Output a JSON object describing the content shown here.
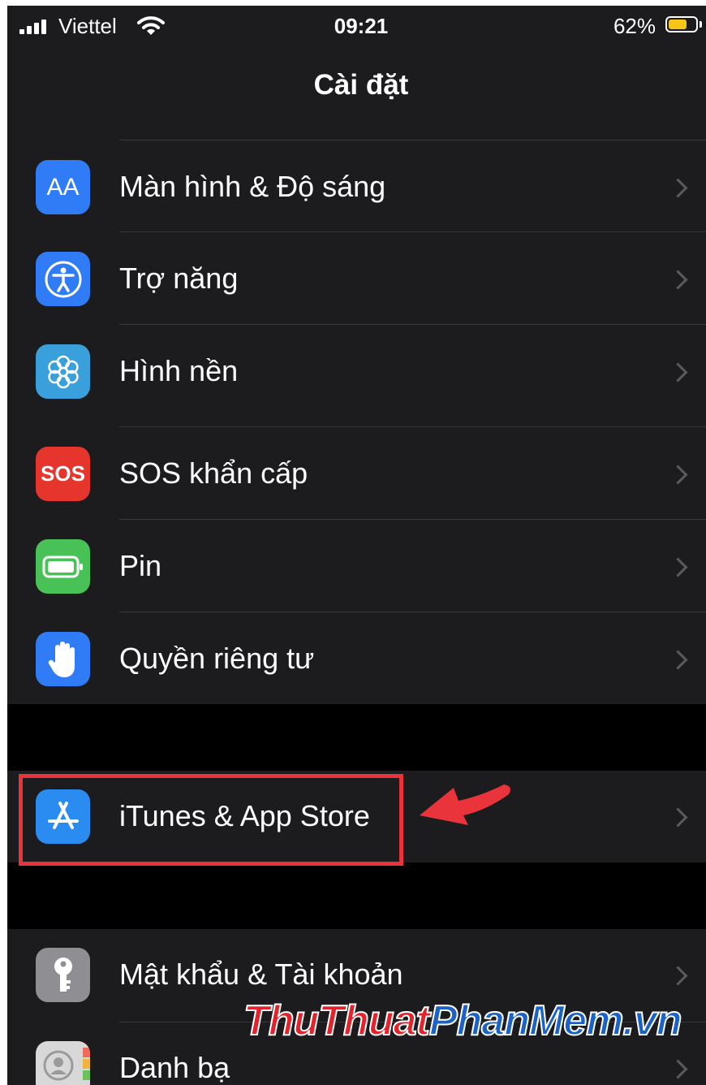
{
  "status_bar": {
    "carrier": "Viettel",
    "time": "09:21",
    "battery_percent": "62%",
    "battery_level": 0.62
  },
  "header": {
    "title": "Cài đặt"
  },
  "groups": [
    {
      "items": [
        {
          "label": "Màn hình & Độ sáng",
          "icon": "display-brightness-icon",
          "icon_text": "AA",
          "color": "#2f7cf6"
        },
        {
          "label": "Trợ năng",
          "icon": "accessibility-icon",
          "color": "#2f7cf6"
        },
        {
          "label": "Hình nền",
          "icon": "wallpaper-icon",
          "color": "#3aa0dc"
        },
        {
          "label": "SOS khẩn cấp",
          "icon": "sos-icon",
          "icon_text": "SOS",
          "color": "#e5352d"
        },
        {
          "label": "Pin",
          "icon": "battery-icon",
          "color": "#48c257"
        },
        {
          "label": "Quyền riêng tư",
          "icon": "privacy-hand-icon",
          "color": "#2f7cf6"
        }
      ]
    },
    {
      "items": [
        {
          "label": "iTunes & App Store",
          "icon": "app-store-icon",
          "color": "#2a8cf0"
        }
      ]
    },
    {
      "items": [
        {
          "label": "Mật khẩu & Tài khoản",
          "icon": "key-icon",
          "color": "#8e8e93"
        },
        {
          "label": "Danh bạ",
          "icon": "contacts-icon",
          "color": "#d8d8d8"
        }
      ]
    }
  ],
  "annotation": {
    "highlight_color": "#e8343a"
  },
  "watermark": {
    "part1": "ThuThuat",
    "part2": "PhanMem.vn"
  }
}
